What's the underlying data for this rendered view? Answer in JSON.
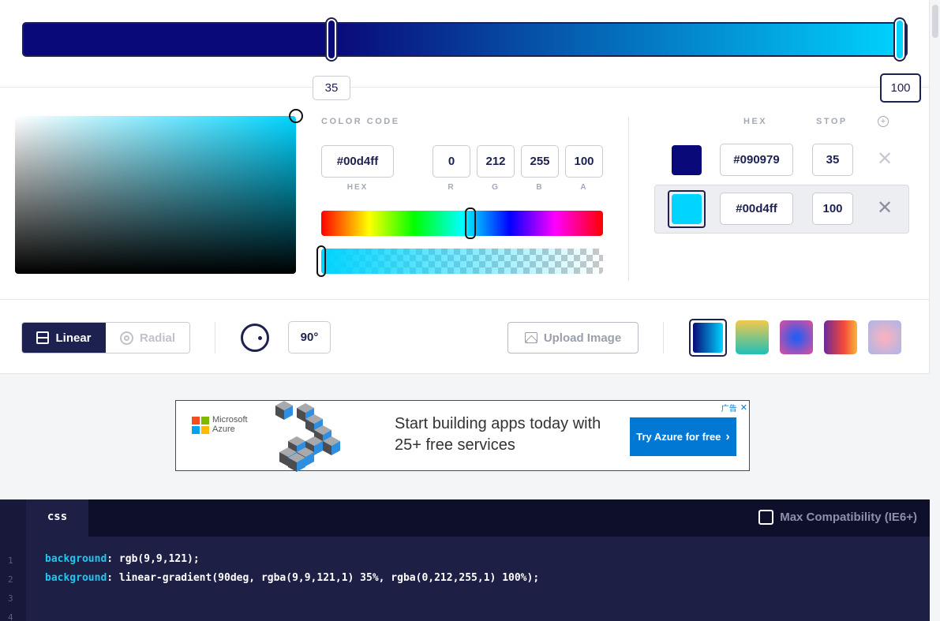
{
  "gradient": {
    "stops": [
      {
        "position": 35,
        "color": "#090979"
      },
      {
        "position": 100,
        "color": "#00d4ff"
      }
    ],
    "stop_labels": [
      "35",
      "100"
    ]
  },
  "picker": {
    "color_code_label": "COLOR CODE",
    "hex_value": "#00d4ff",
    "r": "0",
    "g": "212",
    "b": "255",
    "a": "100",
    "hex_label": "HEX",
    "r_label": "R",
    "g_label": "G",
    "b_label": "B",
    "a_label": "A"
  },
  "stops_table": {
    "hex_header": "HEX",
    "stop_header": "STOP",
    "add_icon": "plus-circle-icon",
    "rows": [
      {
        "hex": "#090979",
        "stop": "35",
        "color": "#090979"
      },
      {
        "hex": "#00d4ff",
        "stop": "100",
        "color": "#00d4ff"
      }
    ]
  },
  "toolbar": {
    "linear_label": "Linear",
    "radial_label": "Radial",
    "angle_value": "90°",
    "upload_label": "Upload Image"
  },
  "presets": [
    "linear-gradient(90deg, #090979, #00d4ff)",
    "linear-gradient(180deg, #f2c94c, #1fbfb8)",
    "radial-gradient(circle, #2b5cf0 10%, #e0509a 100%)",
    "linear-gradient(90deg, #6b2a9a, #f4493b 60%, #f8b43a)",
    "radial-gradient(circle, #f6b2c2 10%, #a9b6e8 100%)"
  ],
  "ad": {
    "brand_line1": "Microsoft",
    "brand_line2": "Azure",
    "headline": "Start building apps today with 25+ free services",
    "cta": "Try Azure for free",
    "badge": "广告"
  },
  "code": {
    "tab": "css",
    "compat_label": "Max Compatibility (IE6+)",
    "line_numbers": [
      "1",
      "2",
      "3",
      "4"
    ],
    "lines": [
      {
        "prop": "background",
        "value": ": rgb(9,9,121);"
      },
      {
        "prop": "background",
        "value": ": linear-gradient(90deg, rgba(9,9,121,1) 35%, rgba(0,212,255,1) 100%);"
      }
    ]
  },
  "colors": {
    "brand_navy": "#1d2150",
    "accent_cyan": "#00d4ff",
    "dark_blue": "#090979"
  }
}
